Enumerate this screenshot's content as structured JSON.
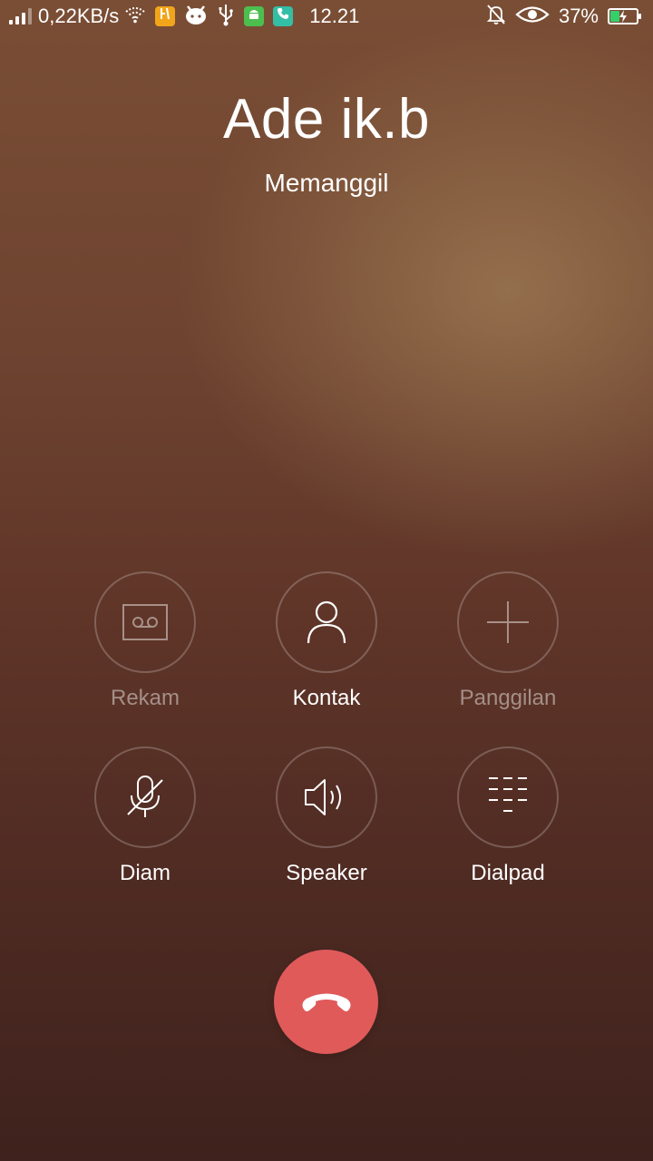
{
  "status_bar": {
    "net_speed": "0,22KB/s",
    "time": "12.21",
    "battery_percent": "37%",
    "battery_level": 0.37,
    "icons_left": [
      "signal-icon",
      "wifi-icon",
      "app-notification-icon",
      "android-face-icon",
      "usb-icon",
      "android-icon",
      "phone-call-icon"
    ],
    "icons_right": [
      "mute-bell-icon",
      "eye-icon",
      "battery-icon"
    ]
  },
  "caller": {
    "name": "Ade ik.b",
    "status": "Memanggil"
  },
  "controls": {
    "record": {
      "label": "Rekam",
      "icon": "voicemail-icon",
      "enabled": false
    },
    "contacts": {
      "label": "Kontak",
      "icon": "person-icon",
      "enabled": true
    },
    "add_call": {
      "label": "Panggilan",
      "icon": "plus-icon",
      "enabled": false
    },
    "mute": {
      "label": "Diam",
      "icon": "mic-off-icon",
      "enabled": true
    },
    "speaker": {
      "label": "Speaker",
      "icon": "speaker-icon",
      "enabled": true
    },
    "dialpad": {
      "label": "Dialpad",
      "icon": "dialpad-icon",
      "enabled": true
    }
  },
  "end_call": {
    "icon": "hang-up-icon",
    "color": "#e05a5a"
  }
}
